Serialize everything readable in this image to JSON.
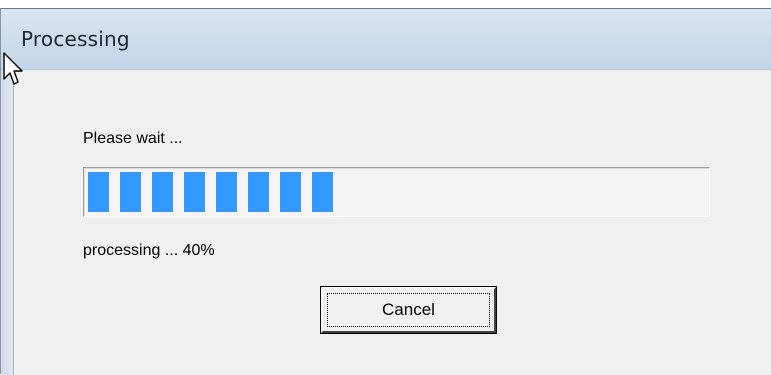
{
  "window": {
    "title": "Processing"
  },
  "dialog": {
    "message": "Please wait ...",
    "status_text": "processing ... 40%",
    "progress_percent": 40,
    "progress_visible_segments": 8,
    "cancel_label": "Cancel"
  },
  "colors": {
    "progress_fill": "#3399ff",
    "title_bar": "#cddcec",
    "client_background": "#f0f0f0"
  },
  "icons": {
    "cursor": "arrow-cursor-icon"
  }
}
